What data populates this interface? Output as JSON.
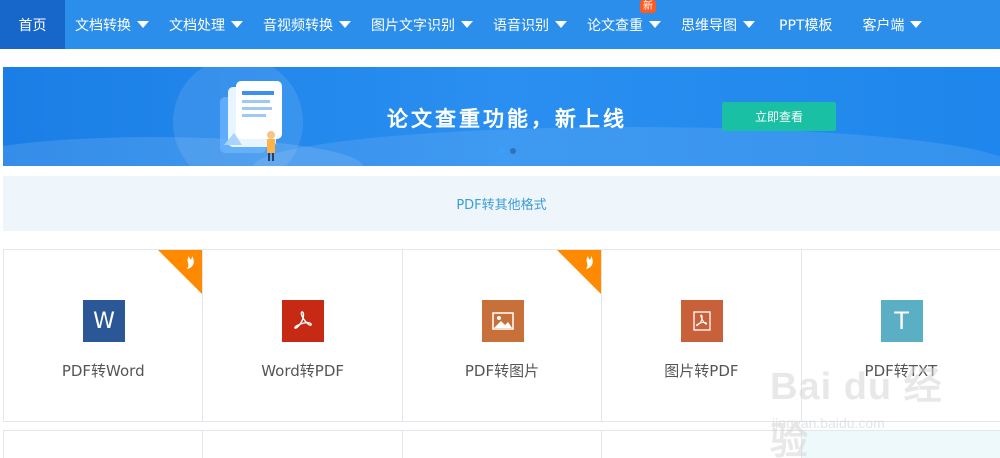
{
  "nav": {
    "items": [
      {
        "label": "首页",
        "dropdown": false
      },
      {
        "label": "文档转换",
        "dropdown": true
      },
      {
        "label": "文档处理",
        "dropdown": true
      },
      {
        "label": "音视频转换",
        "dropdown": true
      },
      {
        "label": "图片文字识别",
        "dropdown": true
      },
      {
        "label": "语音识别",
        "dropdown": true
      },
      {
        "label": "论文查重",
        "dropdown": true,
        "badge": "新"
      },
      {
        "label": "思维导图",
        "dropdown": true
      },
      {
        "label": "PPT模板",
        "dropdown": false
      },
      {
        "label": "客户端",
        "dropdown": true
      }
    ]
  },
  "banner": {
    "title": "论文查重功能，新上线",
    "button": "立即查看"
  },
  "section": {
    "title": "PDF转其他格式"
  },
  "tools": [
    {
      "label": "PDF转Word",
      "icon": "word-icon",
      "glyph": "W",
      "color": "#2b5797",
      "hot": true
    },
    {
      "label": "Word转PDF",
      "icon": "pdf-icon",
      "glyph": "",
      "color": "#c62a14",
      "hot": false
    },
    {
      "label": "PDF转图片",
      "icon": "image-icon",
      "glyph": "",
      "color": "#c8703a",
      "hot": true
    },
    {
      "label": "图片转PDF",
      "icon": "pdf-icon",
      "glyph": "",
      "color": "#c8603a",
      "hot": false
    },
    {
      "label": "PDF转TXT",
      "icon": "txt-icon",
      "glyph": "T",
      "color": "#5aafc4",
      "hot": false
    }
  ],
  "watermark": {
    "brand": "Bai du 经验",
    "url": "jingyan.baidu.com"
  },
  "colors": {
    "nav_bg": "#2b8eea",
    "nav_active": "#1766c9",
    "banner_button": "#19c0a3",
    "hot_badge": "#ff8a00"
  }
}
